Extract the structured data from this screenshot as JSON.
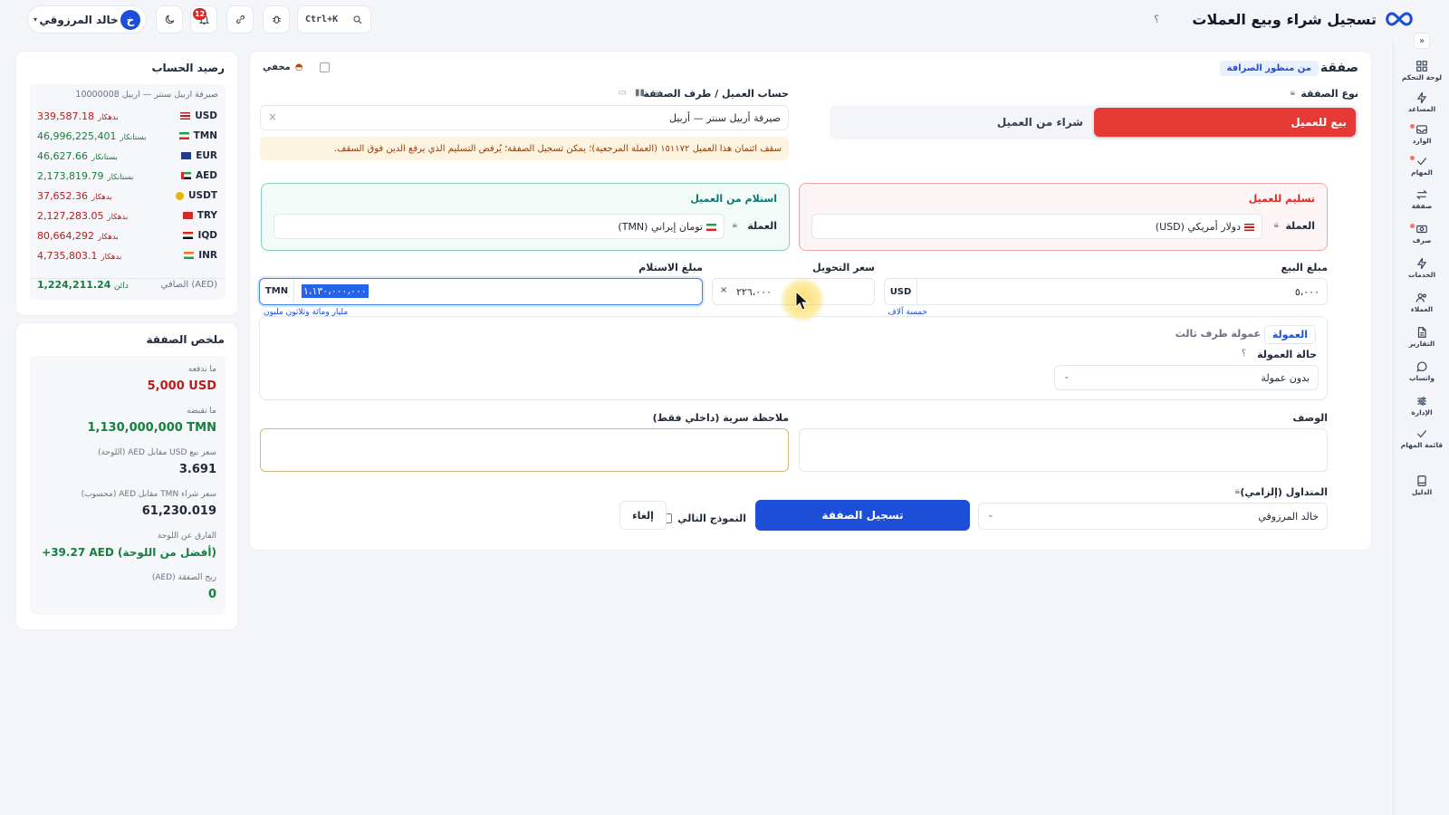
{
  "header": {
    "title": "تسجيل شراء وبيع العملات",
    "help": "؟",
    "search_shortcut": "Ctrl+K",
    "notifications_count": "12",
    "user_name": "خالد المرزوقي",
    "user_initial": "خ"
  },
  "sidebar": {
    "collapse": "»",
    "items": [
      {
        "label": "لوحة التحكم",
        "icon": "dashboard-icon"
      },
      {
        "label": "المساعد",
        "icon": "bolt-icon"
      },
      {
        "label": "الوارد",
        "icon": "inbox-icon"
      },
      {
        "label": "المهام",
        "icon": "check-icon"
      },
      {
        "label": "صفقة",
        "icon": "swap-icon"
      },
      {
        "label": "صرف",
        "icon": "cash-icon"
      },
      {
        "label": "الخدمات",
        "icon": "bolt-icon"
      },
      {
        "label": "العملاء",
        "icon": "users-icon"
      },
      {
        "label": "التقارير",
        "icon": "file-icon"
      },
      {
        "label": "واتساب",
        "icon": "chat-icon"
      },
      {
        "label": "الإدارة",
        "icon": "sliders-icon"
      },
      {
        "label": "قائمة المهام",
        "icon": "check-icon"
      },
      {
        "label": "الدليل",
        "icon": "book-icon"
      }
    ]
  },
  "deal": {
    "title": "صفقة",
    "perspective_badge": "من منظور الصرافة",
    "hidden_label": "مخفي",
    "deal_type_label": "نوع الصفقة",
    "sell_button": "بيع للعميل",
    "buy_button": "شراء من العميل",
    "account_label": "حساب العميل / طرف الصفقة",
    "account_value": "صيرفة أربيل سنتر — أربيل",
    "account_clear": "×",
    "credit_warning": "سقف ائتمان هذا العميل ١٥١١٧٢ (العملة المرجعية)؛ يمكن تسجيل الصفقة؛ يُرفض التسليم الذي يرفع الدين فوق السقف.",
    "deliver_title": "تسليم للعميل",
    "deliver_currency_label": "العملة",
    "deliver_currency_value": "دولار أمريكي (USD)",
    "receive_title": "استلام من العميل",
    "receive_currency_label": "العملة",
    "receive_currency_value": "تومان إيراني (TMN)",
    "sell_amount_label": "مبلغ البيع",
    "sell_amount_currency": "USD",
    "sell_amount_value": "٥،٠٠٠",
    "sell_amount_words": "خمسة آلاف",
    "rate_label": "سعر التحويل",
    "rate_multiplier": "×",
    "rate_value": "٢٢٦،٠٠٠",
    "receive_amount_label": "مبلغ الاستلام",
    "receive_amount_currency": "TMN",
    "receive_amount_value": "١،١٣٠،٠٠٠،٠٠٠",
    "receive_amount_words": "مليار ومائة وثلاثون مليون",
    "commission_tab": "العمولة",
    "third_party_tab": "عمولة طرف ثالث",
    "commission_status_label": "حالة العمولة",
    "commission_status_help": "؟",
    "commission_status_value": "بدون عمولة",
    "description_label": "الوصف",
    "secret_note_label": "ملاحظة سرية (داخلي فقط)",
    "trader_label": "المتداول (إلزامي)",
    "trader_value": "خالد المرزوقي",
    "submit_button": "تسجيل الصفقة",
    "next_form_label": "النموذج التالي",
    "cancel_button": "إلغاء"
  },
  "balance": {
    "title": "رصيد الحساب",
    "account": "صيرفة اربيل سنتر — اربيل 10000008",
    "rows": [
      {
        "code": "USD",
        "amount": "339,587.18",
        "side": "بدهكار",
        "status": "debit",
        "flag": "us"
      },
      {
        "code": "TMN",
        "amount": "46,996,225,401",
        "side": "بستانكار",
        "status": "credit",
        "flag": "ir"
      },
      {
        "code": "EUR",
        "amount": "46,627.66",
        "side": "بستانكار",
        "status": "credit",
        "flag": "eu"
      },
      {
        "code": "AED",
        "amount": "2,173,819.79",
        "side": "بستانكار",
        "status": "credit",
        "flag": "ae"
      },
      {
        "code": "USDT",
        "amount": "37,652.36",
        "side": "بدهكار",
        "status": "debit",
        "flag": "usdt"
      },
      {
        "code": "TRY",
        "amount": "2,127,283.05",
        "side": "بدهكار",
        "status": "debit",
        "flag": "tr"
      },
      {
        "code": "IQD",
        "amount": "80,664,292",
        "side": "بدهكار",
        "status": "debit",
        "flag": "iq"
      },
      {
        "code": "INR",
        "amount": "4,735,803.1",
        "side": "بدهكار",
        "status": "debit",
        "flag": "in"
      }
    ],
    "net_label": "الصافي (AED)",
    "net_amount": "1,224,211.24",
    "net_side": "دائن"
  },
  "summary": {
    "title": "ملخص الصفقة",
    "pay_label": "ما ندفعه",
    "pay_value": "5,000 USD",
    "receive_label": "ما نقبضه",
    "receive_value": "1,130,000,000 TMN",
    "sell_rate_label": "سعر بيع USD مقابل AED (اللوحة)",
    "sell_rate_value": "3.691",
    "buy_rate_label": "سعر شراء TMN مقابل AED (محسوب)",
    "buy_rate_value": "61,230.019",
    "diff_label": "الفارق عن اللوحة",
    "diff_value": "+39.27 AED (أفضل من اللوحة)",
    "profit_label": "ربح الصفقة (AED)",
    "profit_value": "0"
  },
  "colors": {
    "primary": "#1d4ed8",
    "danger": "#e53935",
    "success": "#15803d",
    "debit": "#b91c1c",
    "warning_bg": "#fdf3e1"
  }
}
